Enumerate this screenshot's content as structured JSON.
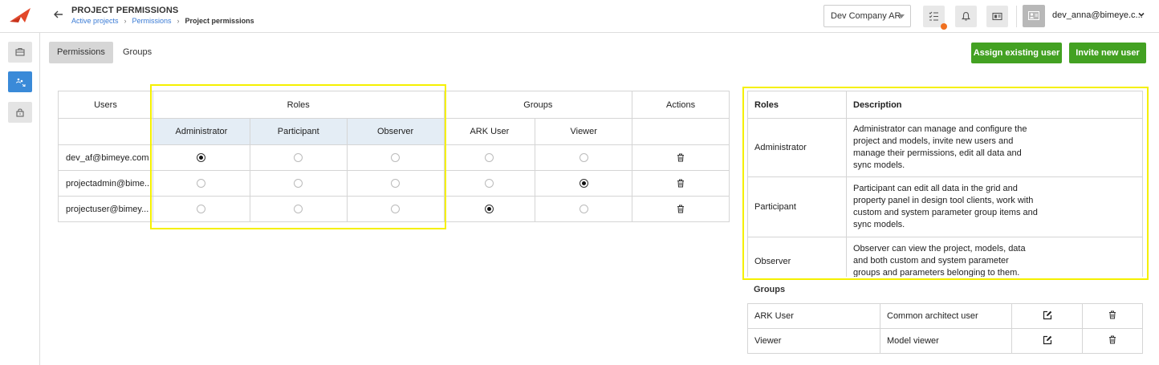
{
  "header": {
    "title": "PROJECT PERMISSIONS",
    "breadcrumb": [
      "Active projects",
      "Permissions",
      "Project permissions"
    ],
    "company": "Dev Company AR",
    "user_email": "dev_anna@bimeye.c..."
  },
  "sidebar": {
    "items": [
      {
        "icon": "briefcase-icon"
      },
      {
        "icon": "permissions-icon",
        "active": true
      },
      {
        "icon": "lock-icon"
      }
    ]
  },
  "tabs": [
    {
      "label": "Permissions",
      "active": true
    },
    {
      "label": "Groups",
      "active": false
    }
  ],
  "actions": {
    "assign_label": "Assign existing user",
    "invite_label": "Invite new user"
  },
  "permissions_table": {
    "headers": {
      "users": "Users",
      "roles": "Roles",
      "groups": "Groups",
      "actions": "Actions"
    },
    "role_columns": [
      "Administrator",
      "Participant",
      "Observer"
    ],
    "group_columns": [
      "ARK User",
      "Viewer"
    ],
    "rows": [
      {
        "user": "dev_af@bimeye.com",
        "role": "Administrator",
        "group": null
      },
      {
        "user": "projectadmin@bime...",
        "role": null,
        "group": "Viewer"
      },
      {
        "user": "projectuser@bimey...",
        "role": null,
        "group": "ARK User"
      }
    ]
  },
  "roles_table": {
    "headers": {
      "role": "Roles",
      "description": "Description"
    },
    "rows": [
      {
        "role": "Administrator",
        "description": "Administrator can manage and configure the project and models, invite new users and manage their permissions, edit all data and sync models."
      },
      {
        "role": "Participant",
        "description": "Participant can edit all data in the grid and property panel in design tool clients, work with custom and system parameter group items and sync models."
      },
      {
        "role": "Observer",
        "description": "Observer can view the project, models, data and both custom and system parameter groups and parameters belonging to them."
      }
    ]
  },
  "groups_table": {
    "title": "Groups",
    "rows": [
      {
        "name": "ARK User",
        "description": "Common architect user"
      },
      {
        "name": "Viewer",
        "description": "Model viewer"
      }
    ]
  },
  "colors": {
    "accent_blue": "#3a8ad8",
    "green_button": "#43a122",
    "highlight": "#f5f000",
    "notification": "#f07020"
  }
}
